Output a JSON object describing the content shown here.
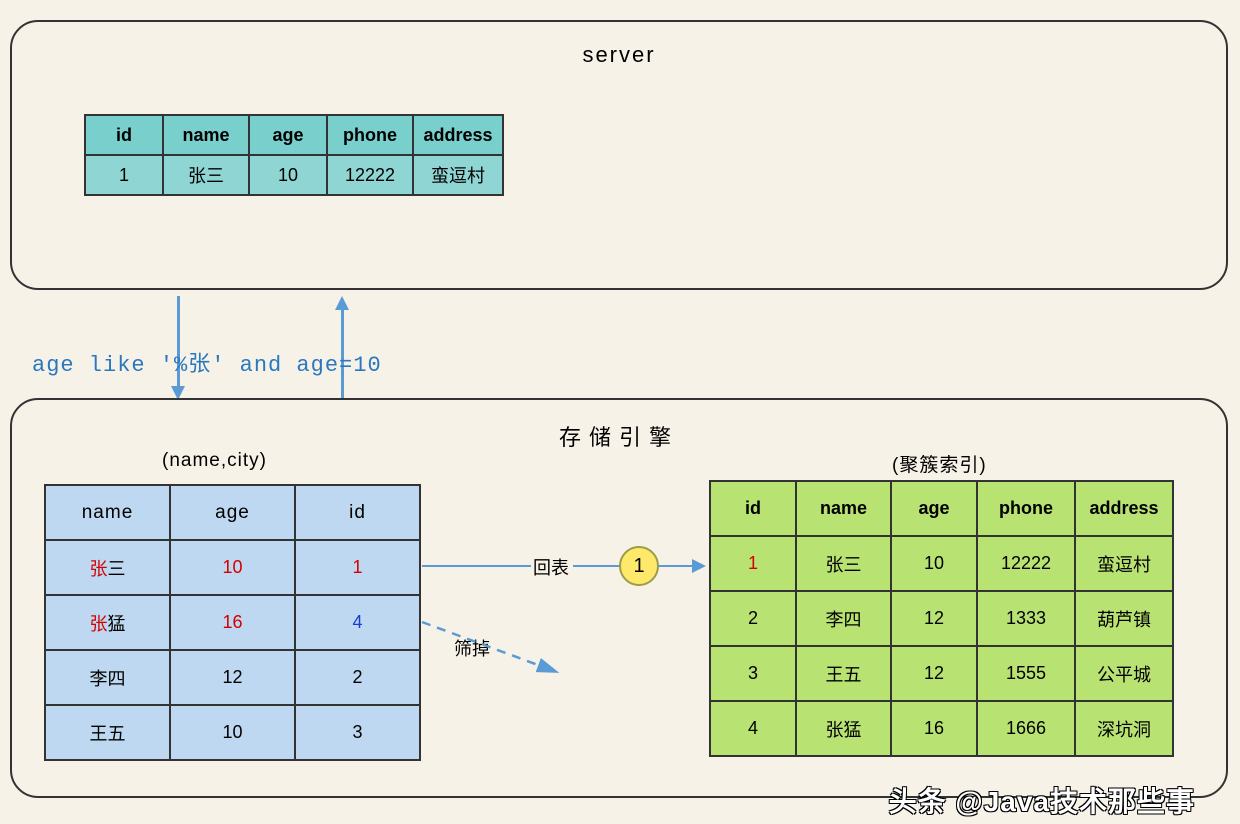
{
  "server": {
    "title": "server",
    "table": {
      "headers": [
        "id",
        "name",
        "age",
        "phone",
        "address"
      ],
      "row": [
        "1",
        "张三",
        "10",
        "12222",
        "蛮逗村"
      ]
    }
  },
  "sql": "age like '%张' and age=10",
  "engine": {
    "title": "存储引擎",
    "index_label": "(name,city)",
    "clustered_label": "(聚簇索引)",
    "arrow_label": "回表",
    "filter_label": "筛掉",
    "badge": "1",
    "index_table": {
      "headers": [
        "name",
        "age",
        "id"
      ],
      "rows": [
        {
          "cells": [
            "张三",
            "10",
            "1"
          ],
          "styles": [
            "part-red",
            "red",
            "red"
          ]
        },
        {
          "cells": [
            "张猛",
            "16",
            "4"
          ],
          "styles": [
            "part-red",
            "red",
            "blue"
          ]
        },
        {
          "cells": [
            "李四",
            "12",
            "2"
          ],
          "styles": [
            "",
            "",
            ""
          ]
        },
        {
          "cells": [
            "王五",
            "10",
            "3"
          ],
          "styles": [
            "",
            "",
            ""
          ]
        }
      ]
    },
    "clustered_table": {
      "headers": [
        "id",
        "name",
        "age",
        "phone",
        "address"
      ],
      "rows": [
        {
          "cells": [
            "1",
            "张三",
            "10",
            "12222",
            "蛮逗村"
          ],
          "id_style": "red"
        },
        {
          "cells": [
            "2",
            "李四",
            "12",
            "1333",
            "葫芦镇"
          ],
          "id_style": ""
        },
        {
          "cells": [
            "3",
            "王五",
            "12",
            "1555",
            "公平城"
          ],
          "id_style": ""
        },
        {
          "cells": [
            "4",
            "张猛",
            "16",
            "1666",
            "深坑洞"
          ],
          "id_style": ""
        }
      ]
    }
  },
  "watermark": "头条 @Java技术那些事"
}
